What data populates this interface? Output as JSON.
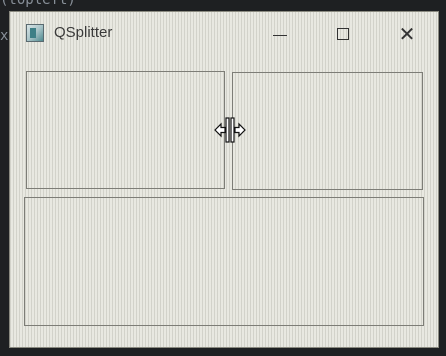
{
  "window": {
    "title": "QSplitter",
    "icon": "qt-app-icon",
    "controls": {
      "minimize": "minimize-icon",
      "maximize": "maximize-icon",
      "close": "close-icon",
      "close_glyph": "✕"
    }
  },
  "background_code": {
    "frag_top": "(topleft)",
    "frag_left": "x"
  },
  "cursor": "split-horizontal-cursor-icon"
}
